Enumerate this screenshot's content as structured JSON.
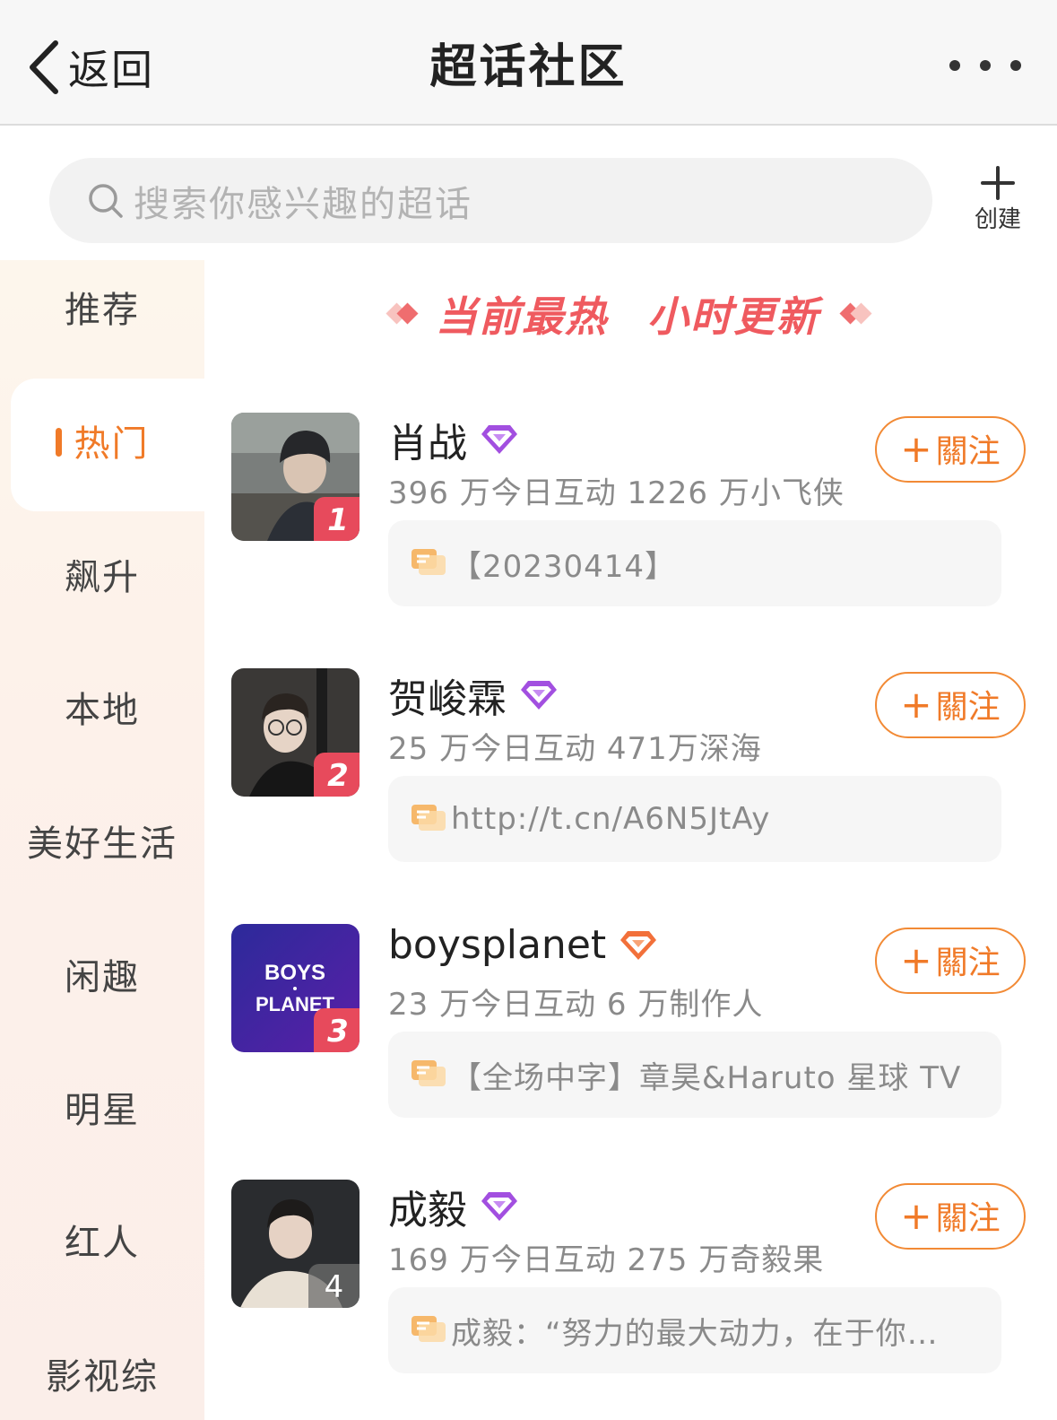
{
  "header": {
    "back_label": "返回",
    "title": "超话社区",
    "more_icon": "more-dots-icon"
  },
  "search": {
    "placeholder": "搜索你感兴趣的超话",
    "create_label": "创建"
  },
  "sidebar": {
    "items": [
      {
        "label": "推荐",
        "active": false
      },
      {
        "label": "热门",
        "active": true
      },
      {
        "label": "飙升",
        "active": false
      },
      {
        "label": "本地",
        "active": false
      },
      {
        "label": "美好生活",
        "active": false
      },
      {
        "label": "闲趣",
        "active": false
      },
      {
        "label": "明星",
        "active": false
      },
      {
        "label": "红人",
        "active": false
      },
      {
        "label": "影视综",
        "active": false
      }
    ]
  },
  "banner": {
    "left_text": "当前最热",
    "right_text": "小时更新"
  },
  "list": [
    {
      "rank": "1",
      "name": "肖战",
      "badge": "purple-diamond",
      "stats": "396 万今日互动 1226 万小飞侠",
      "follow_label": "關注",
      "post": "【20230414】"
    },
    {
      "rank": "2",
      "name": "贺峻霖",
      "badge": "purple-diamond",
      "stats": "25 万今日互动 471万深海",
      "follow_label": "關注",
      "post": "http://t.cn/A6N5JtAy"
    },
    {
      "rank": "3",
      "name": "boysplanet",
      "badge": "orange-diamond",
      "avatar_text_1": "BOYS",
      "avatar_text_2": "PLANET",
      "stats": "23 万今日互动 6 万制作人",
      "follow_label": "關注",
      "post": "【全场中字】章昊&Haruto 星球 TV"
    },
    {
      "rank": "4",
      "name": "成毅",
      "badge": "purple-diamond",
      "stats": "169 万今日互动 275 万奇毅果",
      "follow_label": "關注",
      "post": "成毅：“努力的最大动力，在于你…"
    }
  ],
  "colors": {
    "accent": "#f07a28",
    "banner_red": "#ef5a5f",
    "rank_red": "#e74a5c",
    "purple_badge": "#a24fe0",
    "orange_badge": "#f2703a"
  }
}
